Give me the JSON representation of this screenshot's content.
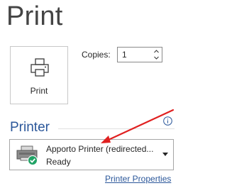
{
  "page": {
    "title": "Print"
  },
  "print_button": {
    "label": "Print",
    "icon": "printer-icon"
  },
  "copies": {
    "label": "Copies:",
    "value": "1"
  },
  "printer_section": {
    "title": "Printer",
    "info_icon": "info-icon",
    "selected_printer": {
      "name": "Apporto Printer (redirected...",
      "status": "Ready",
      "icon": "printer-ready-icon"
    },
    "properties_link": "Printer Properties"
  },
  "annotation": {
    "arrow_color": "#e02020"
  },
  "colors": {
    "accent": "#2b579a",
    "ready_badge": "#21a366"
  }
}
